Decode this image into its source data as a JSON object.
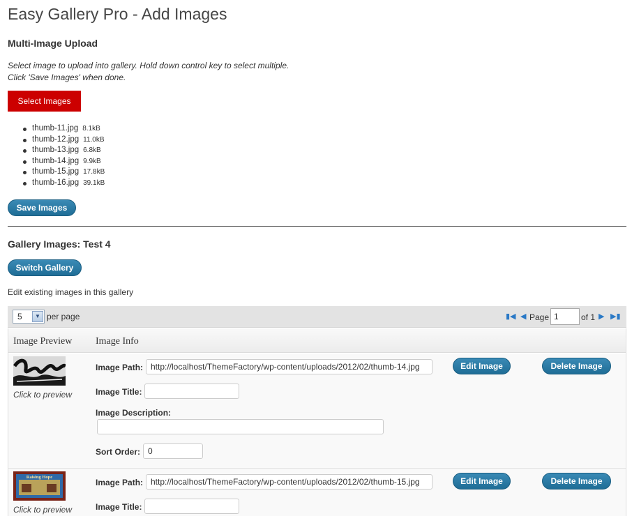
{
  "page": {
    "title": "Easy Gallery Pro - Add Images"
  },
  "upload": {
    "heading": "Multi-Image Upload",
    "desc_line1": "Select image to upload into gallery. Hold down control key to select multiple.",
    "desc_line2": "Click 'Save Images' when done.",
    "select_label": "Select Images",
    "files": [
      {
        "name": "thumb-11.jpg",
        "size": "8.1kB"
      },
      {
        "name": "thumb-12.jpg",
        "size": "11.0kB"
      },
      {
        "name": "thumb-13.jpg",
        "size": "6.8kB"
      },
      {
        "name": "thumb-14.jpg",
        "size": "9.9kB"
      },
      {
        "name": "thumb-15.jpg",
        "size": "17.8kB"
      },
      {
        "name": "thumb-16.jpg",
        "size": "39.1kB"
      }
    ],
    "save_label": "Save Images"
  },
  "gallery": {
    "heading": "Gallery Images: Test 4",
    "switch_label": "Switch Gallery",
    "subtitle": "Edit existing images in this gallery"
  },
  "pager": {
    "per_page_value": "5",
    "per_page_label": "per page",
    "page_label": "Page",
    "page_value": "1",
    "of_label": "of 1"
  },
  "table": {
    "col_preview": "Image Preview",
    "col_info": "Image Info",
    "rows": [
      {
        "preview_caption": "Click to preview",
        "path_label": "Image Path:",
        "path_value": "http://localhost/ThemeFactory/wp-content/uploads/2012/02/thumb-14.jpg",
        "title_label": "Image Title:",
        "title_value": "",
        "desc_label": "Image Description:",
        "desc_value": "",
        "sort_label": "Sort Order:",
        "sort_value": "0",
        "edit_label": "Edit Image",
        "delete_label": "Delete Image"
      },
      {
        "preview_caption": "Click to preview",
        "thumb_text": "Raising Hope",
        "path_label": "Image Path:",
        "path_value": "http://localhost/ThemeFactory/wp-content/uploads/2012/02/thumb-15.jpg",
        "title_label": "Image Title:",
        "title_value": "",
        "edit_label": "Edit Image",
        "delete_label": "Delete Image"
      }
    ]
  },
  "colors": {
    "accent_red": "#cc0000",
    "button_blue": "#1f6d96",
    "link_blue": "#2a79c6"
  }
}
